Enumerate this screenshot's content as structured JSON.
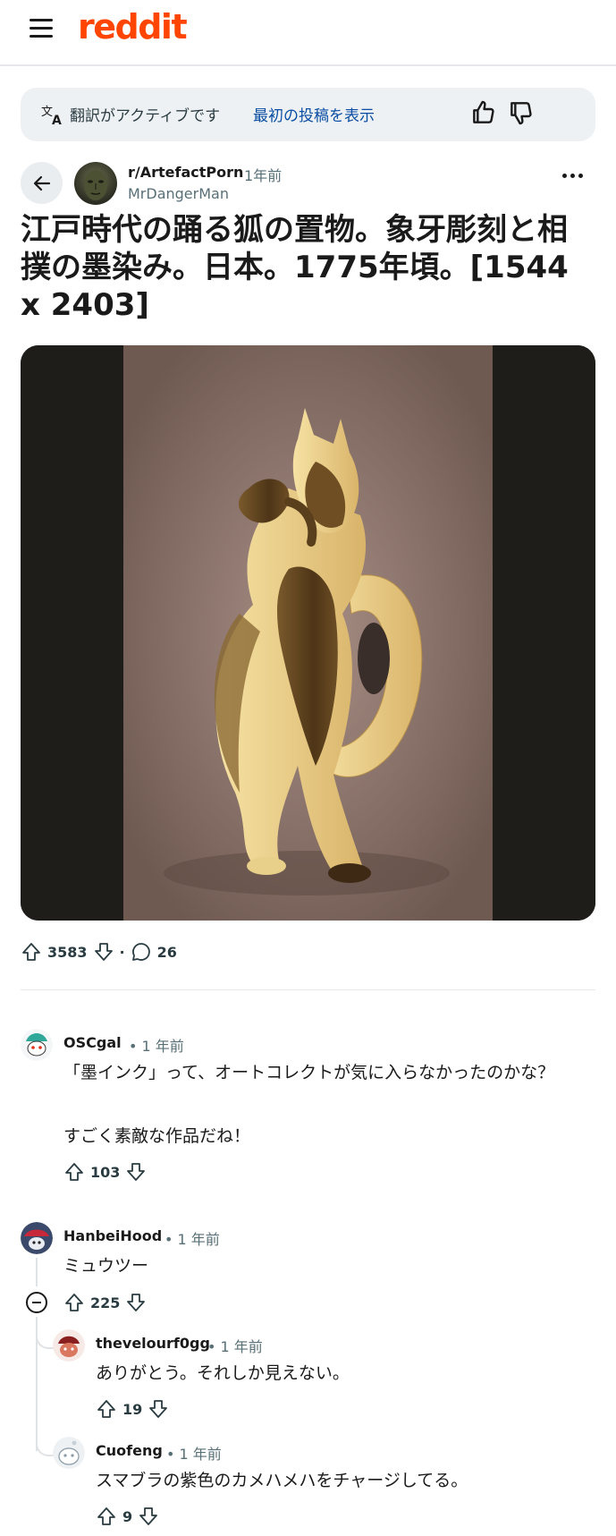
{
  "header": {
    "logo": "reddit",
    "menu_icon": "hamburger-menu-icon"
  },
  "translation_banner": {
    "status": "翻訳がアクティブです",
    "link": "最初の投稿を表示",
    "icons": [
      "translate-icon",
      "thumbs-up-icon",
      "thumbs-down-icon"
    ]
  },
  "post": {
    "subreddit": "r/ArtefactPorn",
    "age": "1年前",
    "author": "MrDangerMan",
    "title": "江戸時代の踊る狐の置物。象牙彫刻と相撲の墨染み。日本。1775年頃。[1544 x 2403]",
    "upvotes": "3583",
    "separator": "·",
    "comments": "26"
  },
  "comments": [
    {
      "user": "OSCgal",
      "time": "• 1 年前",
      "body1": "「墨インク」って、オートコレクトが気に入らなかったのかな？",
      "body2": "すごく素敵な作品だね！",
      "votes": "103"
    },
    {
      "user": "HanbeiHood",
      "time": "• 1 年前",
      "body1": "ミュウツー",
      "votes": "225"
    },
    {
      "user": "thevelourf0gg",
      "time": "• 1 年前",
      "body1": "ありがとう。それしか見えない。",
      "votes": "19"
    },
    {
      "user": "Cuofeng",
      "time": "• 1 年前",
      "body1": "スマブラの紫色のカメハメハをチャージしてる。",
      "votes": "9"
    }
  ],
  "colors": {
    "brand": "#ff4500",
    "link": "#0a4ea3",
    "muted": "#576f76"
  }
}
